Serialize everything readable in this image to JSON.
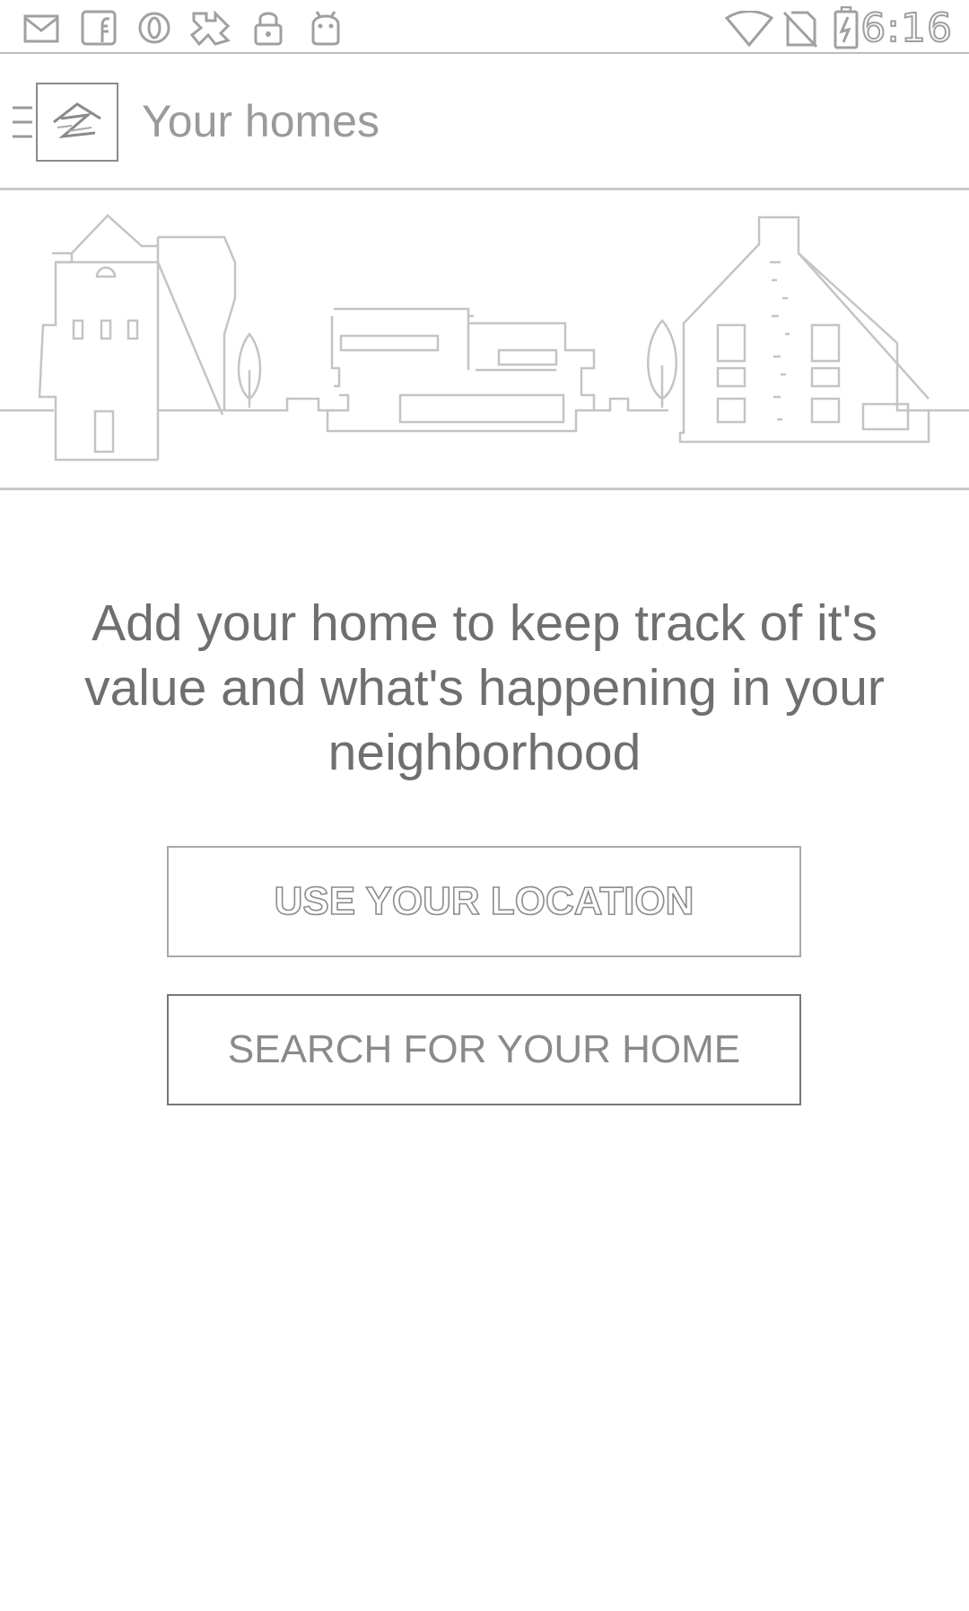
{
  "status_bar": {
    "time": "6:16",
    "icons_left": [
      "email-icon",
      "facebook-icon",
      "opera-icon",
      "puzzle-icon",
      "lock-icon",
      "android-icon"
    ],
    "icons_right": [
      "wifi-icon",
      "no-sim-icon",
      "battery-charging-icon"
    ]
  },
  "app_bar": {
    "title": "Your homes",
    "menu_icon": "hamburger-menu-icon",
    "logo_icon": "zillow-logo-icon"
  },
  "hero": {
    "illustration": "neighborhood-houses-illustration"
  },
  "main": {
    "message": "Add your home to keep track of it's value and what's happening in your neighborhood",
    "use_location_label": "USE YOUR LOCATION",
    "search_home_label": "SEARCH FOR YOUR HOME"
  },
  "colors": {
    "background": "#ffffff",
    "text": "#6f6f6f",
    "border": "#a8a8a8",
    "divider": "#c9c9c9"
  }
}
